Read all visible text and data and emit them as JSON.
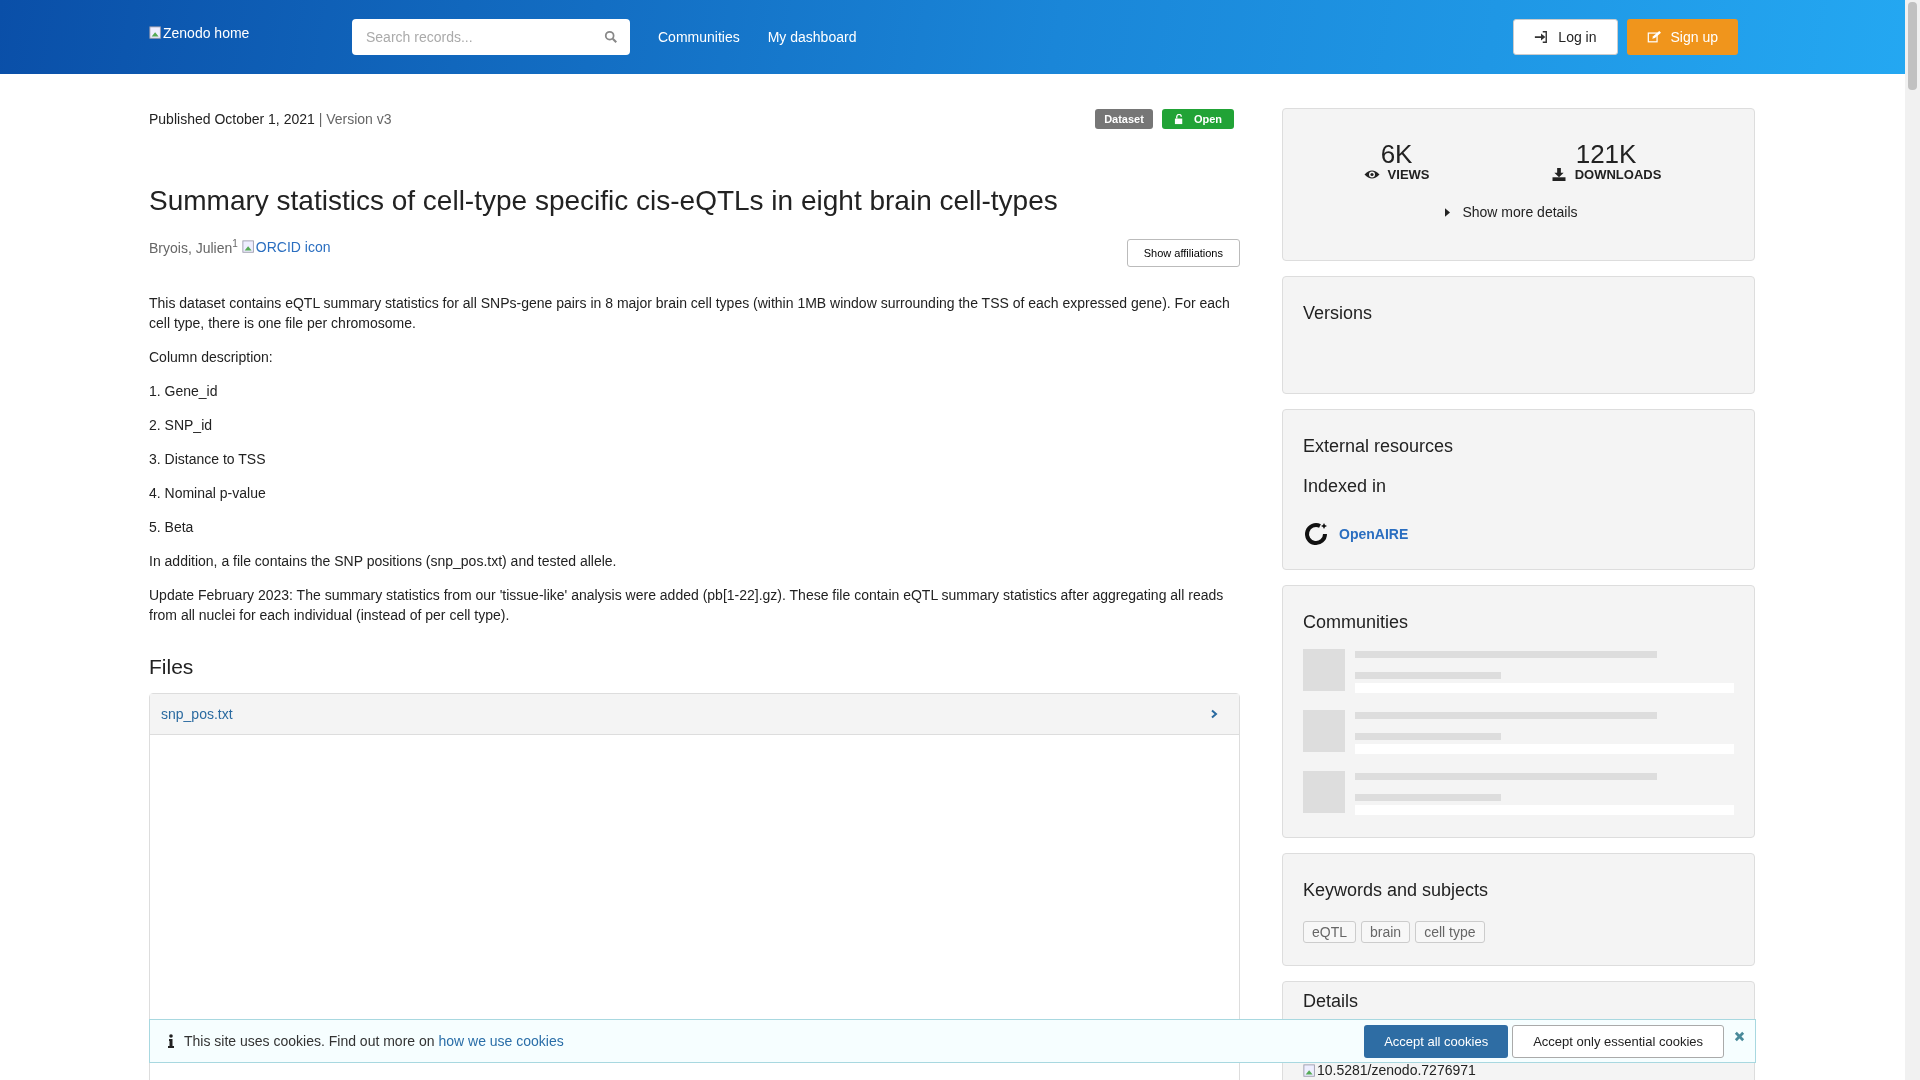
{
  "header": {
    "logo_alt": "Zenodo home",
    "search": {
      "placeholder": "Search records..."
    },
    "nav": [
      "Communities",
      "My dashboard"
    ],
    "login": "Log in",
    "signup": "Sign up"
  },
  "record": {
    "published": "Published October 1, 2021",
    "version": "| Version v3",
    "badges": [
      {
        "kind": "type",
        "label": "Dataset"
      },
      {
        "kind": "access",
        "label": "Open"
      }
    ],
    "title": "Summary statistics of cell-type specific cis-eQTLs in eight brain cell-types",
    "author": "Bryois, Julien",
    "author_mark": "1",
    "orcid_alt": "ORCID icon",
    "affiliations_button": "Show affiliations",
    "description": [
      "This dataset contains eQTL summary statistics for all SNPs-gene pairs in 8 major brain cell types (within 1MB window surrounding the TSS of each expressed gene). For each cell type, there is one file per chromosome.",
      "Column description:",
      "1. Gene_id",
      "2. SNP_id",
      "3. Distance to TSS",
      "4. Nominal p-value",
      "5. Beta",
      "In addition, a file contains the SNP positions (snp_pos.txt) and tested allele.",
      "Update February 2023: The summary statistics from our 'tissue-like' analysis were added (pb[1-22].gz). These file contain eQTL summary statistics after aggregating all reads from all nuclei for each individual (instead of per cell type)."
    ],
    "files_heading": "Files",
    "file": {
      "name": "snp_pos.txt",
      "expanded": false
    }
  },
  "sidebar": {
    "stats": [
      {
        "kind": "views",
        "value": "6K",
        "label": "VIEWS"
      },
      {
        "kind": "downloads",
        "value": "121K",
        "label": "DOWNLOADS"
      }
    ],
    "more_details": "Show more details",
    "versions": {
      "title": "Versions"
    },
    "external": {
      "title": "External resources",
      "subtitle": "Indexed in",
      "link": "OpenAIRE"
    },
    "communities": {
      "title": "Communities",
      "loading": true
    },
    "keywords": {
      "title": "Keywords and subjects",
      "items": [
        "eQTL",
        "brain",
        "cell type"
      ]
    },
    "details": {
      "title": "Details",
      "doi_alt": "10.5281/zenodo.7276971"
    }
  },
  "cookie_banner": {
    "text": "This site uses cookies. Find out more on",
    "link": "how we use cookies",
    "accept_all": "Accept all cookies",
    "accept_essential": "Accept only essential cookies"
  }
}
